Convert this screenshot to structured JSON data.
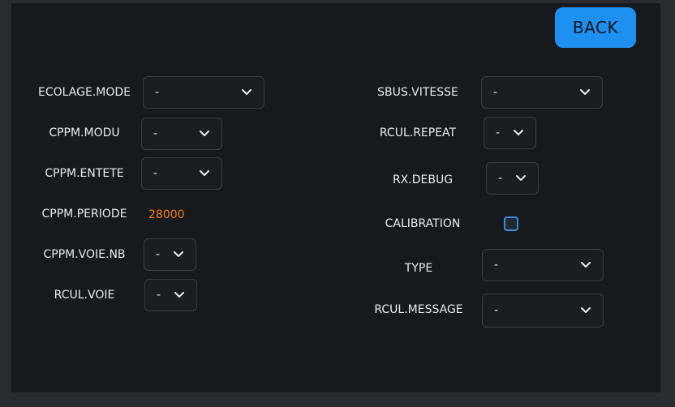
{
  "back_label": "BACK",
  "left": {
    "ecolage_mode": {
      "label": "ECOLAGE.MODE",
      "value": "-"
    },
    "cppm_modu": {
      "label": "CPPM.MODU",
      "value": "-"
    },
    "cppm_entete": {
      "label": "CPPM.ENTETE",
      "value": "-"
    },
    "cppm_periode": {
      "label": "CPPM.PERIODE",
      "value": "28000"
    },
    "cppm_voie_nb": {
      "label": "CPPM.VOIE.NB",
      "value": "-"
    },
    "rcul_voie": {
      "label": "RCUL.VOIE",
      "value": "-"
    }
  },
  "right": {
    "sbus_vitesse": {
      "label": "SBUS.VITESSE",
      "value": "-"
    },
    "rcul_repeat": {
      "label": "RCUL.REPEAT",
      "value": "-"
    },
    "rx_debug": {
      "label": "RX.DEBUG",
      "value": "-"
    },
    "calibration": {
      "label": "CALIBRATION",
      "checked": false
    },
    "type": {
      "label": "TYPE",
      "value": "-"
    },
    "rcul_message": {
      "label": "RCUL.MESSAGE",
      "value": "-"
    }
  },
  "colors": {
    "accent": "#1e90f0",
    "value_orange": "#ff7a1a",
    "panel_bg": "#17191c"
  },
  "icons": {
    "dropdown": "chevron-down-icon"
  }
}
